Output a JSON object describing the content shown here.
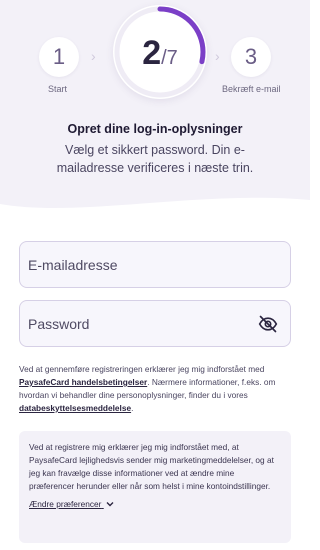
{
  "stepper": {
    "prev_step": "1",
    "prev_label": "Start",
    "current_step": "2",
    "total_steps": "/7",
    "next_step": "3",
    "next_label": "Bekræft e-mail",
    "progress_fraction": 0.2857,
    "accent_color": "#7b3fc7"
  },
  "header": {
    "title": "Opret dine log-in-oplysninger",
    "subtitle": "Vælg et sikkert password. Din e-mailadresse verificeres i næste trin."
  },
  "form": {
    "email_placeholder": "E-mailadresse",
    "password_placeholder": "Password",
    "toggle_icon": "eye-off-icon"
  },
  "terms": {
    "text1": "Ved at gennemføre registreringen erklærer jeg mig indforstået med ",
    "link1": "PaysafeCard handelsbetingelser",
    "text2": ". Nærmere informationer, f.eks. om hvordan vi behandler dine personoplysninger, finder du i vores ",
    "link2": "databeskyttelsesmeddelelse",
    "text3": "."
  },
  "consent": {
    "text": "Ved at registrere mig erklærer jeg mig indforstået med, at PaysafeCard lejlighedsvis sender mig marketingmeddelelser, og at jeg kan fravælge disse informationer ved at ændre mine præferencer herunder eller når som helst i mine kontoindstillinger.",
    "change_label": "Ændre præferencer",
    "chevron_icon": "chevron-down-icon"
  }
}
